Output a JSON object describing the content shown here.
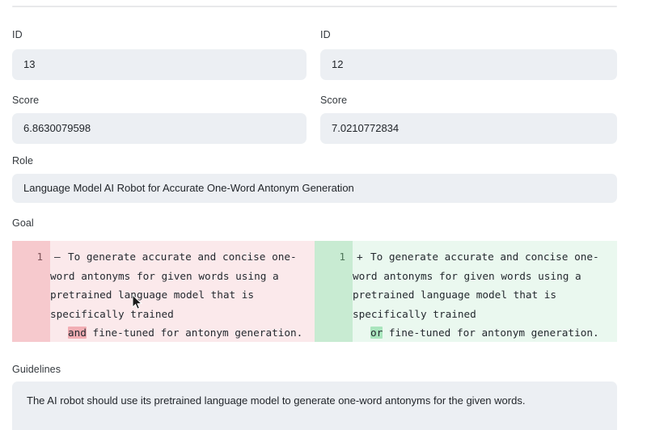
{
  "form": {
    "id_left": {
      "label": "ID",
      "value": "13"
    },
    "id_right": {
      "label": "ID",
      "value": "12"
    },
    "score_left": {
      "label": "Score",
      "value": "6.8630079598"
    },
    "score_right": {
      "label": "Score",
      "value": "7.0210772834"
    },
    "role": {
      "label": "Role",
      "value": "Language Model AI Robot for Accurate One-Word Antonym Generation"
    },
    "goal": {
      "label": "Goal"
    },
    "guidelines": {
      "label": "Guidelines",
      "value": "The AI robot should use its pretrained language model to generate one-word antonyms for the given words."
    }
  },
  "diff": {
    "removed": {
      "line_number": "1",
      "sign": "–",
      "text_before": "To generate accurate and concise one-\nword antonyms for given words using a\npretrained language model that is\nspecifically trained\n",
      "changed_word": "and",
      "text_after": " fine-tuned for antonym generation."
    },
    "added": {
      "line_number": "1",
      "sign": "+",
      "text_before": "To generate accurate and concise one-\nword antonyms for given words using a\npretrained language model that is\nspecifically trained\n",
      "changed_word": "or",
      "text_after": " fine-tuned for antonym generation."
    }
  },
  "colors": {
    "field_bg": "#eceff3",
    "diff_removed_bg": "#fbe9eb",
    "diff_removed_gutter": "#f6c9cd",
    "diff_removed_word": "#f2aeb4",
    "diff_added_bg": "#eaf8ef",
    "diff_added_gutter": "#c8ebd2",
    "diff_added_word": "#a9e5bd",
    "divider": "#e8e9eb"
  }
}
